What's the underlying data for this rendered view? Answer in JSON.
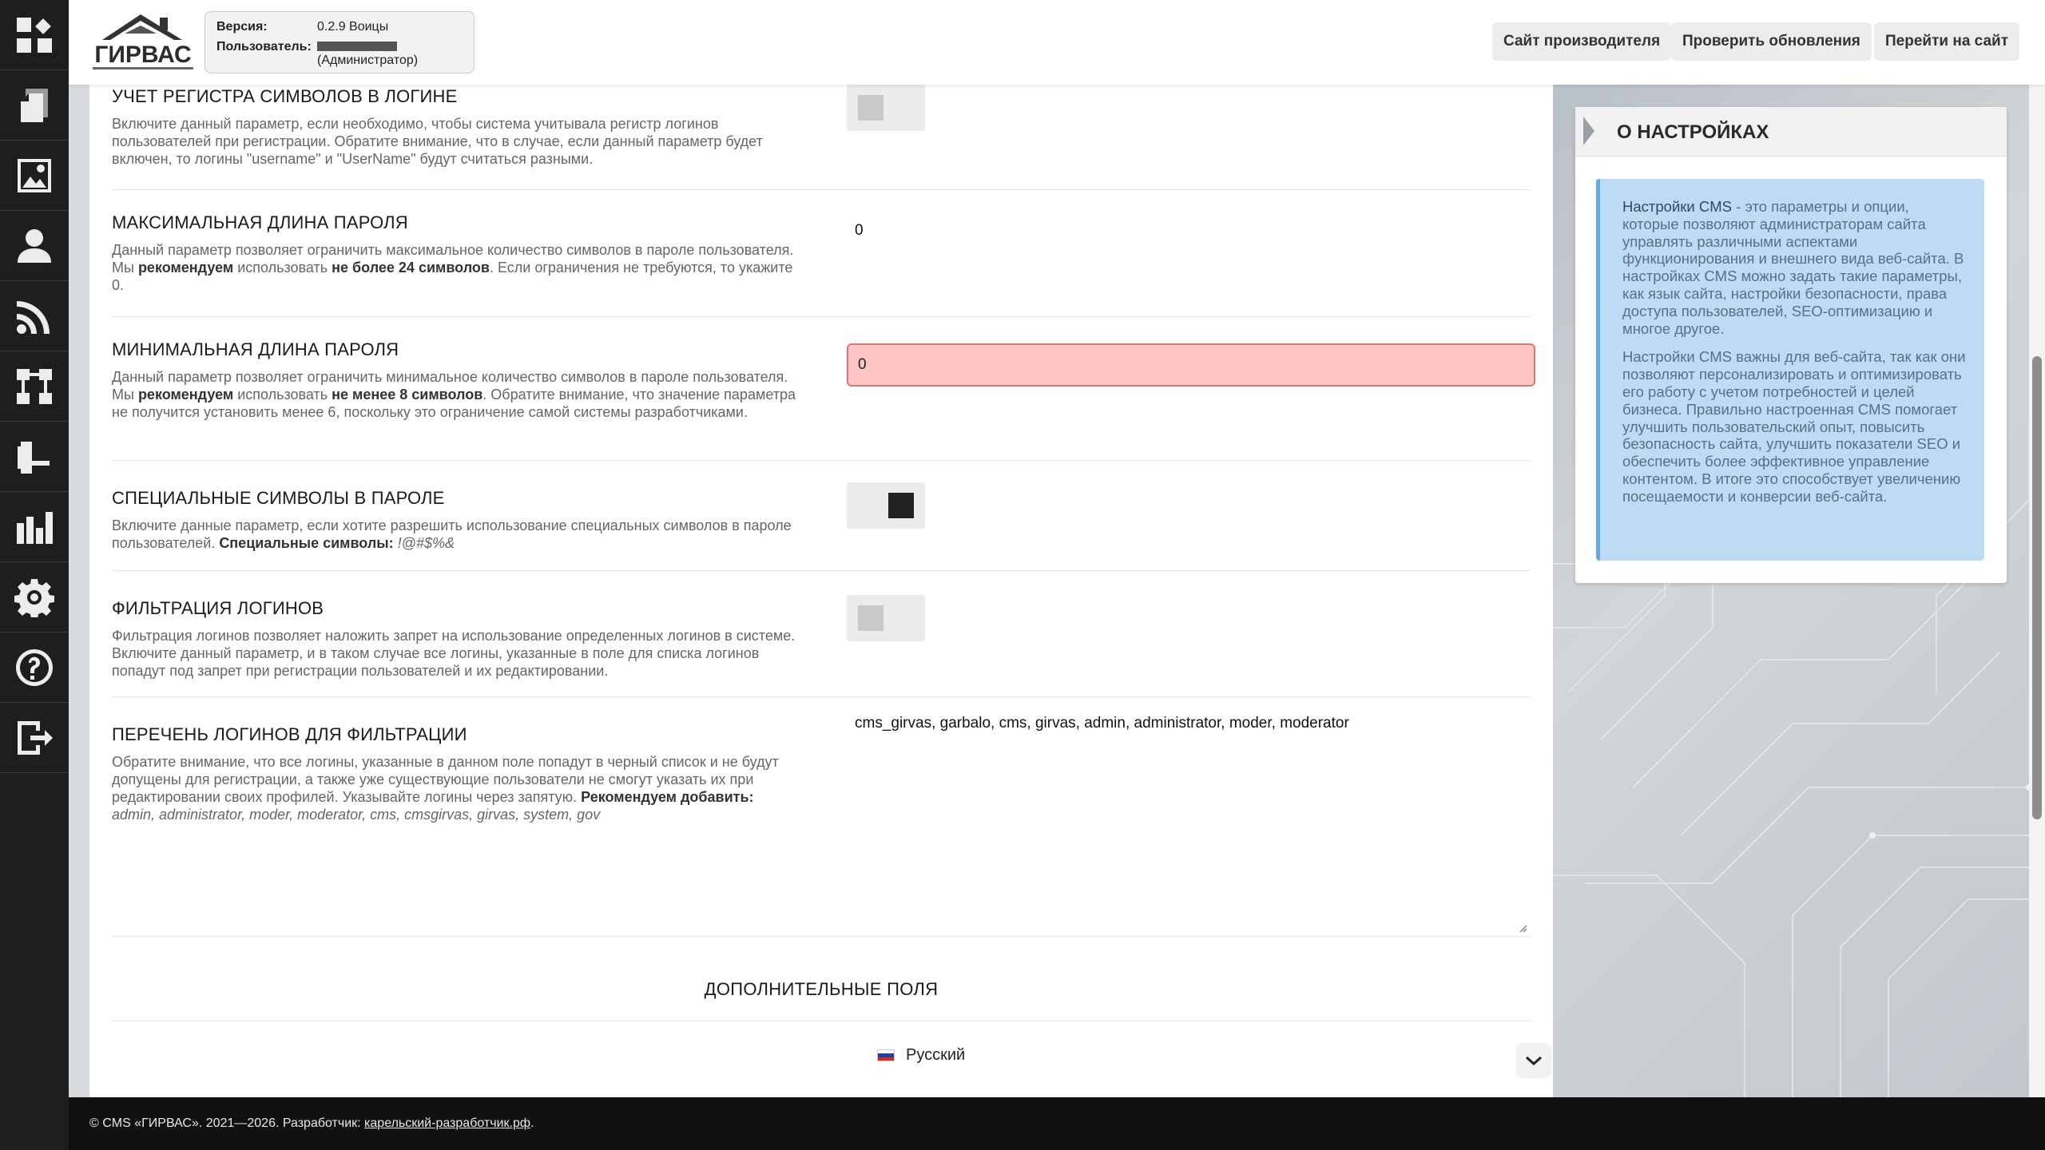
{
  "sidebar": {
    "icons": [
      "dashboard-icon",
      "pages-icon",
      "gallery-icon",
      "users-icon",
      "feed-icon",
      "structure-icon",
      "modules-icon",
      "statistics-icon",
      "settings-icon",
      "help-icon",
      "logout-icon"
    ]
  },
  "header": {
    "logo_text": "ГИРВАС",
    "version_label": "Версия:",
    "version_value": "0.2.9 Воицы",
    "user_label": "Пользователь:",
    "user_role": "(Администратор)",
    "btn_vendor": "Сайт производителя",
    "btn_updates": "Проверить обновления",
    "btn_site": "Перейти на сайт"
  },
  "settings": {
    "login_case": {
      "title": "УЧЕТ РЕГИСТРА СИМВОЛОВ В ЛОГИНЕ",
      "desc": "Включите данный параметр, если необходимо, чтобы система учитывала регистр логинов пользователей при регистрации. Обратите внимание, что в случае, если данный параметр будет включен, то логины \"username\" и \"UserName\" будут считаться разными.",
      "enabled": false
    },
    "max_pass": {
      "title": "МАКСИМАЛЬНАЯ ДЛИНА ПАРОЛЯ",
      "desc_1": "Данный параметр позволяет ограничить максимальное количество символов в пароле пользователя. Мы ",
      "desc_b1": "рекомендуем",
      "desc_2": " использовать ",
      "desc_b2": "не более 24 символов",
      "desc_3": ". Если ограничения не требуются, то укажите 0.",
      "value": "0"
    },
    "min_pass": {
      "title": "МИНИМАЛЬНАЯ ДЛИНА ПАРОЛЯ",
      "desc_1": "Данный параметр позволяет ограничить минимальное количество символов в пароле пользователя. Мы ",
      "desc_b1": "рекомендуем",
      "desc_2": " использовать ",
      "desc_b2": "не менее 8 символов",
      "desc_3": ". Обратите внимание, что значение параметра не получится установить менее 6, поскольку это ограничение самой системы разработчиками.",
      "value": "0"
    },
    "special_chars": {
      "title": "СПЕЦИАЛЬНЫЕ СИМВОЛЫ В ПАРОЛЕ",
      "desc_1": "Включите данные параметр, если хотите разрешить использование специальных символов в пароле пользователей. ",
      "desc_b": "Специальные символы:",
      "desc_i": " !@#$%&",
      "enabled": true
    },
    "login_filter": {
      "title": "ФИЛЬТРАЦИЯ ЛОГИНОВ",
      "desc": "Фильтрация логинов позволяет наложить запрет на использование определенных логинов в системе. Включите данный параметр, и в таком случае все логины, указанные в поле для списка логинов попадут под запрет при регистрации пользователей и их редактировании.",
      "enabled": false
    },
    "filter_list": {
      "title": "ПЕРЕЧЕНЬ ЛОГИНОВ ДЛЯ ФИЛЬТРАЦИИ",
      "desc_1": "Обратите внимание, что все логины, указанные в данном поле попадут в черный список и не будут допущены для регистрации, а также уже существующие пользователи не смогут указать их при редактировании своих профилей. Указывайте логины через запятую. ",
      "desc_b": "Рекомендуем добавить:",
      "desc_i": " admin, administrator, moder, moderator, cms, cmsgirvas, girvas, system, gov",
      "value": "cms_girvas, garbalo, cms, girvas, admin, administrator, moder, moderator"
    }
  },
  "extra": {
    "title": "ДОПОЛНИТЕЛЬНЫЕ ПОЛЯ",
    "language": "Русский"
  },
  "about": {
    "title": "О НАСТРОЙКАХ",
    "p1_hl": "Настройки CMS",
    "p1": " - это параметры и опции, которые позволяют администраторам сайта управлять различными аспектами функционирования и внешнего вида веб-сайта. В настройках CMS можно задать такие параметры, как язык сайта, настройки безопасности, права доступа пользователей, SEO-оптимизацию и многое другое.",
    "p2": "Настройки CMS важны для веб-сайта, так как они позволяют персонализировать и оптимизировать его работу с учетом потребностей и целей бизнеса. Правильно настроенная CMS помогает улучшить пользовательский опыт, повысить безопасность сайта, улучшить показатели SEO и обеспечить более эффективное управление контентом. В итоге это способствует увеличению посещаемости и конверсии веб-сайта."
  },
  "footer": {
    "text": "© CMS «ГИРВАС». 2021—2026. Разработчик: ",
    "link": "карельский-разработчик.рф",
    "end": "."
  },
  "colors": {
    "sidebar": "#1e1e1e",
    "error_input": "#ffc4c4",
    "info_box": "#bcdcf6"
  }
}
